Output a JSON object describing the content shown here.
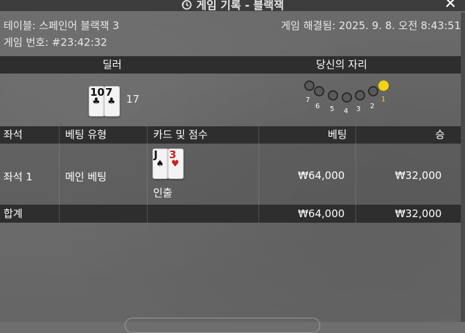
{
  "window": {
    "title": "게임 기록 - 블랙잭",
    "close_icon": "close-icon",
    "history_icon": "history-icon"
  },
  "info": {
    "table": "테이블: 스페인어 블랙잭 3",
    "resolved": "게임 해결됨: 2025. 9. 8. 오전 8:43:51",
    "game_no": "게임 번호: #23:42:32"
  },
  "dealer_section": {
    "dealer_label": "딜러",
    "seat_label": "당신의 자리",
    "dealer_score": "17",
    "dealer_cards": [
      {
        "rank": "10",
        "suit": "♣",
        "color": "black"
      },
      {
        "rank": "7",
        "suit": "♣",
        "color": "black"
      }
    ],
    "seats": [
      {
        "num": "7",
        "active": false
      },
      {
        "num": "6",
        "active": false
      },
      {
        "num": "5",
        "active": false
      },
      {
        "num": "4",
        "active": false
      },
      {
        "num": "3",
        "active": false
      },
      {
        "num": "2",
        "active": false
      },
      {
        "num": "1",
        "active": true
      }
    ],
    "active_color": "#f4d30a"
  },
  "table": {
    "headers": {
      "seat": "좌석",
      "bet_type": "베팅 유형",
      "cards": "카드 및 점수",
      "bet": "베팅",
      "win": "승"
    },
    "rows": [
      {
        "seat": "좌석 1",
        "bet_type": "메인 베팅",
        "cards": [
          {
            "rank": "J",
            "suit": "♠",
            "color": "black"
          },
          {
            "rank": "3",
            "suit": "♥",
            "color": "red"
          }
        ],
        "result": "인출",
        "bet": "₩64,000",
        "win": "₩32,000"
      }
    ],
    "total": {
      "label": "합계",
      "bet": "₩64,000",
      "win": "₩32,000"
    }
  }
}
